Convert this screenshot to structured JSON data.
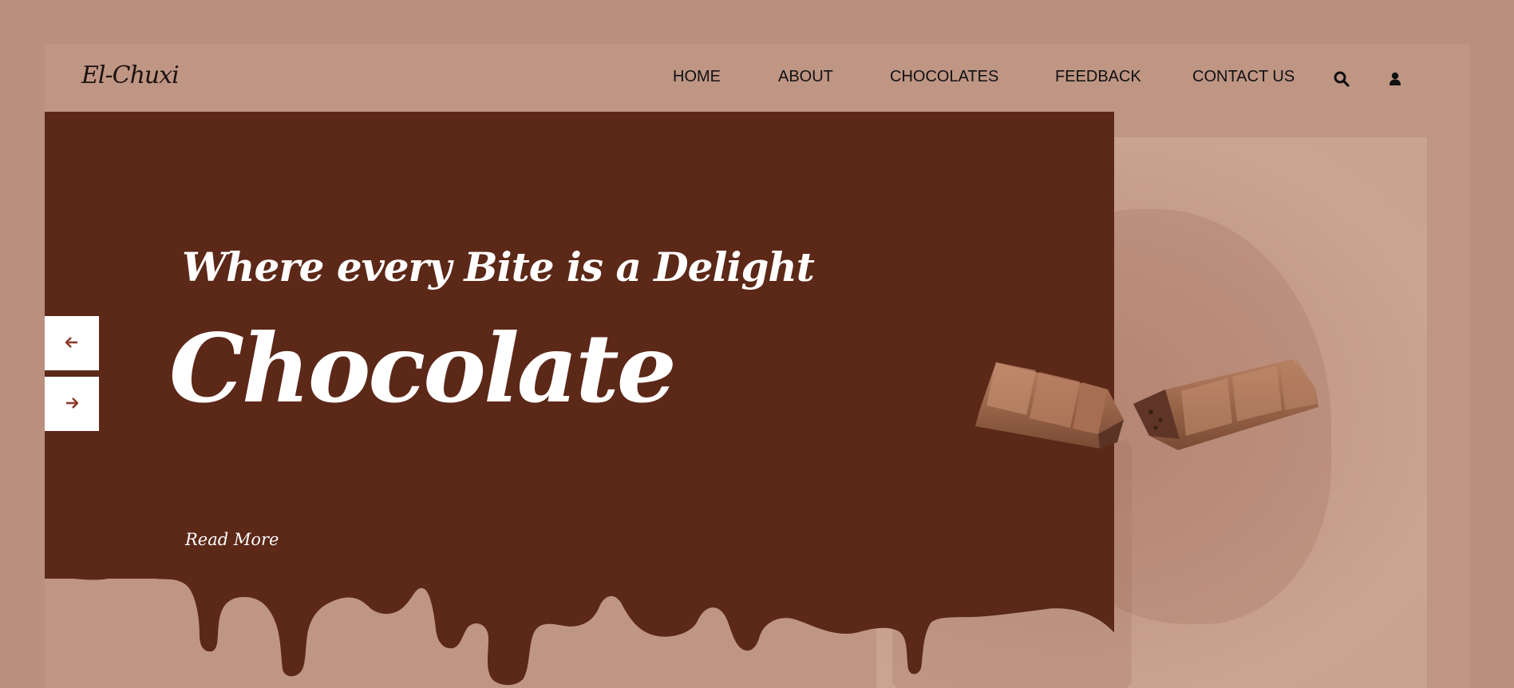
{
  "brand": {
    "logo": "El-Chuxi"
  },
  "nav": {
    "items": [
      {
        "label": "HOME"
      },
      {
        "label": "ABOUT"
      },
      {
        "label": "CHOCOLATES"
      },
      {
        "label": "FEEDBACK"
      },
      {
        "label": "CONTACT US"
      }
    ],
    "icons": [
      "search-icon",
      "user-icon"
    ]
  },
  "hero": {
    "subtitle": "Where every Bite is a Delight",
    "title": "Chocolate",
    "cta_label": "Read More"
  },
  "slider": {
    "prev_symbol": "🡐",
    "next_symbol": "🡒"
  },
  "colors": {
    "background": "#bb8f7d",
    "hero_panel": "#5c2818",
    "accent": "#8b3a2a",
    "text_light": "#ffffff"
  }
}
